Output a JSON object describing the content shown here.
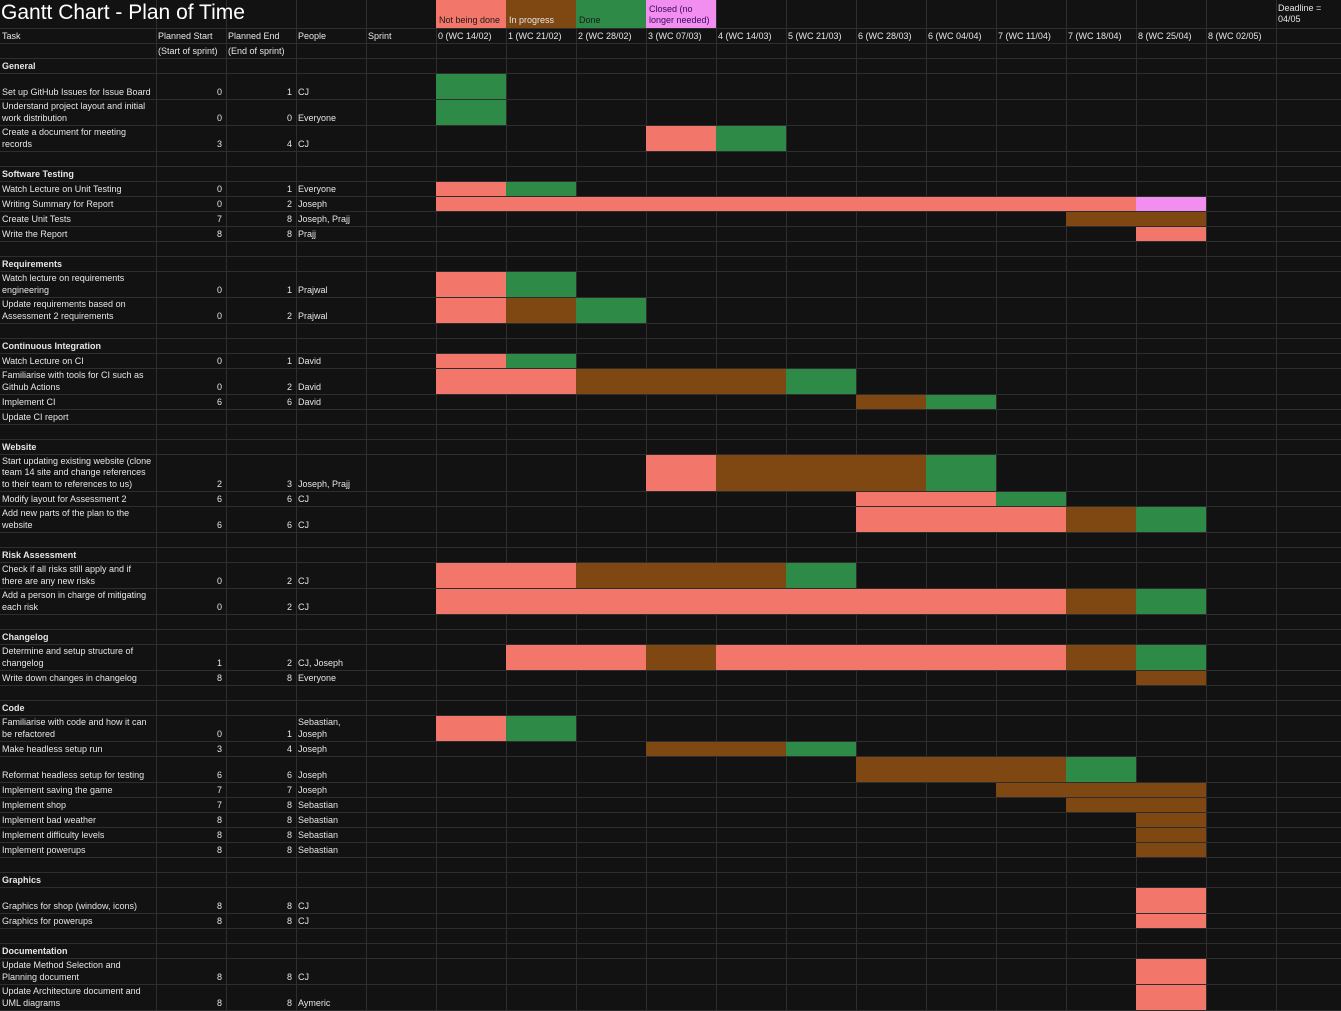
{
  "title": "Gantt Chart - Plan of Time",
  "deadline": "Deadline = 04/05",
  "colors": {
    "not_being_done": "#f27669",
    "in_progress": "#7f4711",
    "done": "#2e8b47",
    "closed": "#f28ef0",
    "background": "#121212",
    "gridline": "#2e2e2e"
  },
  "legend": [
    {
      "label": "Not being done",
      "status": "N"
    },
    {
      "label": "In progress",
      "status": "P"
    },
    {
      "label": "Done",
      "status": "D"
    },
    {
      "label": "Closed (no longer needed)",
      "status": "C"
    }
  ],
  "headers": {
    "task": "Task",
    "planned_start": "Planned Start",
    "planned_start_sub": "(Start of sprint)",
    "planned_end": "Planned End",
    "planned_end_sub": "(End of sprint)",
    "people": "People",
    "sprint": "Sprint"
  },
  "weeks": [
    "0 (WC 14/02)",
    "1 (WC 21/02)",
    "2 (WC 28/02)",
    "3 (WC 07/03)",
    "4 (WC 14/03)",
    "5 (WC 21/03)",
    "6 (WC 28/03)",
    "6 (WC 04/04)",
    "7 (WC 11/04)",
    "7 (WC 18/04)",
    "8 (WC 25/04)",
    "8 (WC 02/05)"
  ],
  "rows": [
    {
      "type": "section",
      "label": "General"
    },
    {
      "type": "task",
      "task": "Set up GitHub Issues for Issue Board",
      "start": "0",
      "end": "1",
      "people": "CJ",
      "bars": "D-----------"
    },
    {
      "type": "task",
      "task": "Understand project layout and initial work distribution",
      "start": "0",
      "end": "0",
      "people": "Everyone",
      "bars": "D-----------"
    },
    {
      "type": "task",
      "task": "Create a document for meeting records",
      "start": "3",
      "end": "4",
      "people": "CJ",
      "bars": "---ND-------"
    },
    {
      "type": "spacer"
    },
    {
      "type": "section",
      "label": "Software Testing"
    },
    {
      "type": "task",
      "task": "Watch Lecture on Unit Testing",
      "start": "0",
      "end": "1",
      "people": "Everyone",
      "bars": "ND----------"
    },
    {
      "type": "task",
      "task": "Writing Summary for Report",
      "start": "0",
      "end": "2",
      "people": "Joseph",
      "bars": "NNNNNNNNNNC-"
    },
    {
      "type": "task",
      "task": "Create Unit Tests",
      "start": "7",
      "end": "8",
      "people": "Joseph, Prajj",
      "bars": "---------PP-"
    },
    {
      "type": "task",
      "task": "Write the Report",
      "start": "8",
      "end": "8",
      "people": "Prajj",
      "bars": "----------N-"
    },
    {
      "type": "spacer"
    },
    {
      "type": "section",
      "label": "Requirements"
    },
    {
      "type": "task",
      "task": "Watch lecture on requirements engineering",
      "start": "0",
      "end": "1",
      "people": "Prajwal",
      "bars": "ND----------"
    },
    {
      "type": "task",
      "task": "Update requirements based on Assessment 2 requirements",
      "start": "0",
      "end": "2",
      "people": "Prajwal",
      "bars": "NPD---------"
    },
    {
      "type": "spacer"
    },
    {
      "type": "section",
      "label": "Continuous Integration"
    },
    {
      "type": "task",
      "task": "Watch Lecture on CI",
      "start": "0",
      "end": "1",
      "people": "David",
      "bars": "ND----------"
    },
    {
      "type": "task",
      "task": "Familiarise with tools for CI such as Github Actions",
      "start": "0",
      "end": "2",
      "people": "David",
      "bars": "NNPPPD------"
    },
    {
      "type": "task",
      "task": "Implement CI",
      "start": "6",
      "end": "6",
      "people": "David",
      "bars": "------PD----"
    },
    {
      "type": "task",
      "task": "Update CI report",
      "start": "",
      "end": "",
      "people": "",
      "bars": "------------"
    },
    {
      "type": "spacer"
    },
    {
      "type": "section",
      "label": "Website"
    },
    {
      "type": "task",
      "task": "Start updating existing website (clone team 14 site and change references to their team to references to us)",
      "start": "2",
      "end": "3",
      "people": "Joseph, Prajj",
      "bars": "---NPPPD----"
    },
    {
      "type": "task",
      "task": "Modify layout for Assessment 2",
      "start": "6",
      "end": "6",
      "people": "CJ",
      "bars": "------NND---"
    },
    {
      "type": "task",
      "task": "Add new parts of the plan to the website",
      "start": "6",
      "end": "6",
      "people": "CJ",
      "bars": "------NNNPD-"
    },
    {
      "type": "spacer"
    },
    {
      "type": "section",
      "label": "Risk Assessment"
    },
    {
      "type": "task",
      "task": "Check if all risks still apply and if there are any new risks",
      "start": "0",
      "end": "2",
      "people": "CJ",
      "bars": "NNPPPD------"
    },
    {
      "type": "task",
      "task": "Add a person in charge of mitigating each risk",
      "start": "0",
      "end": "2",
      "people": "CJ",
      "bars": "NNNNNNNNNPD-"
    },
    {
      "type": "spacer"
    },
    {
      "type": "section",
      "label": "Changelog"
    },
    {
      "type": "task",
      "task": "Determine and setup structure of changelog",
      "start": "1",
      "end": "2",
      "people": "CJ, Joseph",
      "bars": "-NNPNNNNNPD-"
    },
    {
      "type": "task",
      "task": "Write down changes in changelog",
      "start": "8",
      "end": "8",
      "people": "Everyone",
      "bars": "----------P-"
    },
    {
      "type": "spacer"
    },
    {
      "type": "section",
      "label": "Code"
    },
    {
      "type": "task",
      "task": "Familiarise with code and how it can be refactored",
      "start": "0",
      "end": "1",
      "people": "Sebastian, Joseph",
      "bars": "ND----------"
    },
    {
      "type": "task",
      "task": "Make headless setup run",
      "start": "3",
      "end": "4",
      "people": "Joseph",
      "bars": "---PPD------"
    },
    {
      "type": "task",
      "task": "Reformat headless setup for testing",
      "start": "6",
      "end": "6",
      "people": "Joseph",
      "bars": "------PPPD--"
    },
    {
      "type": "task",
      "task": "Implement saving the game",
      "start": "7",
      "end": "7",
      "people": "Joseph",
      "bars": "--------PPP-"
    },
    {
      "type": "task",
      "task": "Implement shop",
      "start": "7",
      "end": "8",
      "people": "Sebastian",
      "bars": "---------PP-"
    },
    {
      "type": "task",
      "task": "Implement bad weather",
      "start": "8",
      "end": "8",
      "people": "Sebastian",
      "bars": "----------P-"
    },
    {
      "type": "task",
      "task": "Implement difficulty levels",
      "start": "8",
      "end": "8",
      "people": "Sebastian",
      "bars": "----------P-"
    },
    {
      "type": "task",
      "task": "Implement powerups",
      "start": "8",
      "end": "8",
      "people": "Sebastian",
      "bars": "----------P-"
    },
    {
      "type": "spacer"
    },
    {
      "type": "section",
      "label": "Graphics"
    },
    {
      "type": "task",
      "task": "Graphics for shop (window, icons)",
      "start": "8",
      "end": "8",
      "people": "CJ",
      "bars": "----------N-"
    },
    {
      "type": "task",
      "task": "Graphics for powerups",
      "start": "8",
      "end": "8",
      "people": "CJ",
      "bars": "----------N-"
    },
    {
      "type": "spacer"
    },
    {
      "type": "section",
      "label": "Documentation"
    },
    {
      "type": "task",
      "task": "Update Method Selection and Planning document",
      "start": "8",
      "end": "8",
      "people": "CJ",
      "bars": "----------N-"
    },
    {
      "type": "task",
      "task": "Update Architecture document and UML diagrams",
      "start": "8",
      "end": "8",
      "people": "Aymeric",
      "bars": "----------N-"
    }
  ]
}
